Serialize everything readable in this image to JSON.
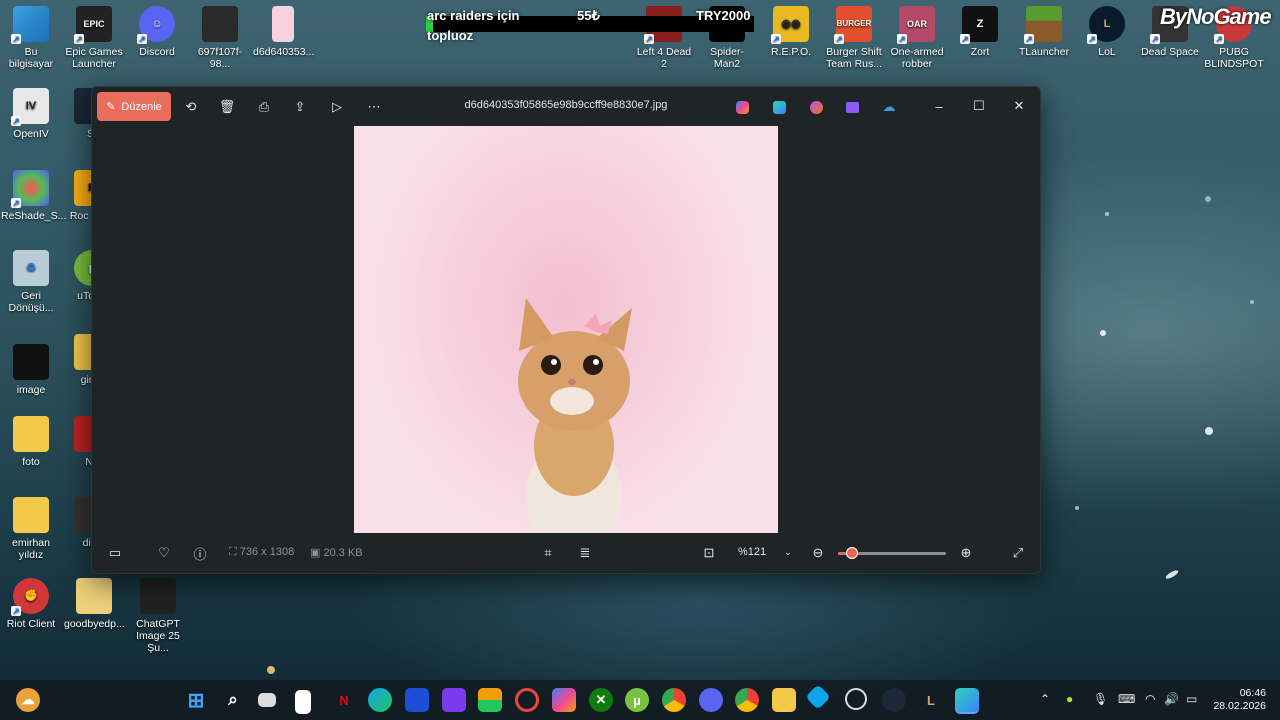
{
  "desktop_icons": {
    "bu_bilgisayar": "Bu bilgisayar",
    "epic": "Epic Games Launcher",
    "discord": "Discord",
    "file1": "697f107f-98...",
    "file2": "d6d640353...",
    "left4dead": "Left 4 Dead 2",
    "spiderman": "Spider-Man2",
    "repo": "R.E.P.O.",
    "burger": "Burger Shift Team Rus...",
    "robber": "One-armed robber",
    "zort": "Zort",
    "tlauncher": "TLauncher",
    "lol": "LoL",
    "deadspace": "Dead Space",
    "pubg": "PUBG BLINDSPOT",
    "openiv": "OpenIV",
    "st": "St",
    "reshade": "ReShade_S...",
    "rockstar": "Roc Gam",
    "recycle": "Geri Dönüşü...",
    "utorrent": "uTorre",
    "image": "image",
    "gimp": "gimp",
    "foto": "foto",
    "ne": "Ne",
    "emirhan": "emirhan yıldız",
    "disc": "disc",
    "riot": "Riot Client",
    "goodbye": "goodbyedp...",
    "chatgpt": "ChatGPT Image 25 Şu..."
  },
  "overlay": {
    "text1": "arc raiders için",
    "text2": "topluoz",
    "amount": "55₺",
    "goal": "TRY2000",
    "progress": 0.02,
    "brand": "ByNoGame"
  },
  "photos": {
    "edit_label": "Düzenle",
    "filename": "d6d640353f05865e98b9ccff9e8830e7.jpg",
    "dimensions": "736 x 1308",
    "filesize": "20.3 KB",
    "zoom": "%121",
    "zoom_fraction": 0.13
  },
  "clock": {
    "time": "06:46",
    "date": "28.02.2026"
  },
  "colors": {
    "accent": "#ea6c5a",
    "window_bg": "#1f2426"
  }
}
